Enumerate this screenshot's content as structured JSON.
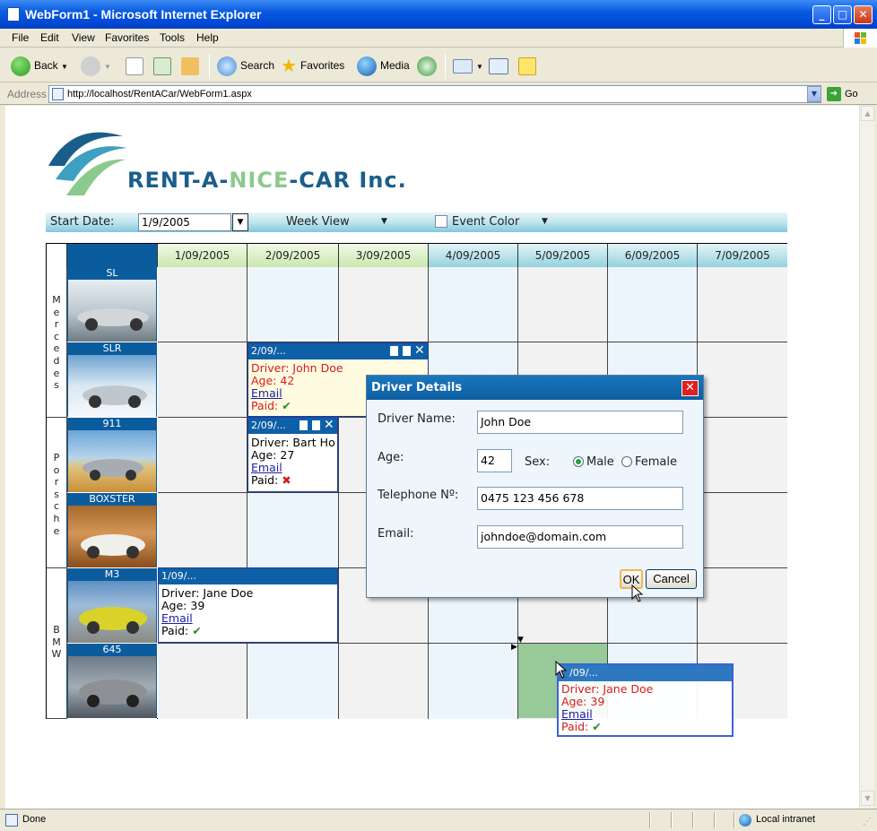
{
  "window": {
    "title": "WebForm1 - Microsoft Internet Explorer",
    "controls": [
      "_",
      "□",
      "✕"
    ]
  },
  "menu": [
    "File",
    "Edit",
    "View",
    "Favorites",
    "Tools",
    "Help"
  ],
  "toolbar": {
    "back": "Back",
    "search": "Search",
    "favorites": "Favorites",
    "media": "Media"
  },
  "address": {
    "label": "Address",
    "url": "http://localhost/RentACar/WebForm1.aspx",
    "go": "Go"
  },
  "status": {
    "text": "Done",
    "zone": "Local intranet"
  },
  "logo": {
    "part1": "RENT-A-",
    "part2": "NICE",
    "part3": "-CAR Inc."
  },
  "controls": {
    "start_date_label": "Start Date:",
    "start_date_value": "1/9/2005",
    "view_mode": "Week View",
    "event_color_label": "Event Color"
  },
  "calendar": {
    "dates": [
      "1/09/2005",
      "2/09/2005",
      "3/09/2005",
      "4/09/2005",
      "5/09/2005",
      "6/09/2005",
      "7/09/2005"
    ],
    "brands": [
      {
        "name": "Mercedes",
        "letters": [
          "M",
          "e",
          "r",
          "c",
          "e",
          "d",
          "e",
          "s"
        ]
      },
      {
        "name": "Porsche",
        "letters": [
          "P",
          "o",
          "r",
          "s",
          "c",
          "h",
          "e"
        ]
      },
      {
        "name": "BMW",
        "letters": [
          "B",
          "M",
          "W"
        ]
      }
    ],
    "cars": [
      "SL",
      "SLR",
      "911",
      "BOXSTER",
      "M3",
      "645"
    ]
  },
  "events": {
    "slr": {
      "header": "2/09/...",
      "driver": "Driver: John Doe",
      "age": "Age: 42",
      "email": "Email",
      "paid": "Paid:"
    },
    "p911": {
      "header": "2/09/...",
      "driver": "Driver: Bart Ho",
      "age": "Age: 27",
      "email": "Email",
      "paid": "Paid:"
    },
    "m3": {
      "header": "1/09/...",
      "driver": "Driver: Jane Doe",
      "age": "Age: 39",
      "email": "Email",
      "paid": "Paid:"
    },
    "ghost": {
      "header": "/09/...",
      "driver": "Driver: Jane Doe",
      "age": "Age: 39",
      "email": "Email",
      "paid": "Paid:"
    }
  },
  "dialog": {
    "title": "Driver Details",
    "name_label": "Driver Name:",
    "name_value": "John Doe",
    "age_label": "Age:",
    "age_value": "42",
    "sex_label": "Sex:",
    "male": "Male",
    "female": "Female",
    "sex_selected": "Male",
    "phone_label": "Telephone Nº:",
    "phone_value": "0475 123 456 678",
    "email_label": "Email:",
    "email_value": "johndoe@domain.com",
    "ok": "OK",
    "cancel": "Cancel"
  }
}
